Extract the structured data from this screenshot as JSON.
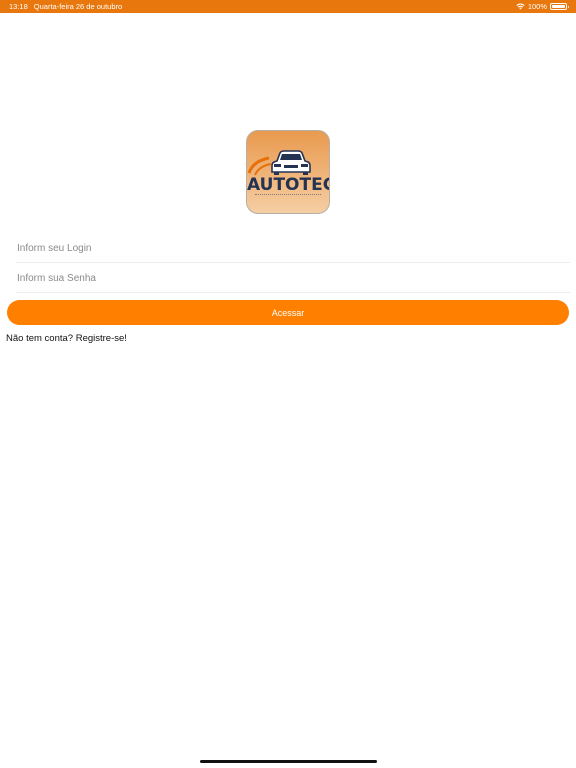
{
  "status_bar": {
    "time": "13:18",
    "date": "Quarta-feira 26 de outubro",
    "battery_text": "100%",
    "battery_level": 1.0,
    "icons": [
      "wifi-icon",
      "battery-icon"
    ]
  },
  "logo": {
    "text": "AUTOTEC",
    "icon": "car-icon"
  },
  "form": {
    "login_placeholder": "Inform seu Login",
    "senha_placeholder": "Inform sua Senha",
    "login_value": "",
    "senha_value": "",
    "submit_label": "Acessar",
    "register_text": "Não tem conta? Registre-se!"
  },
  "colors": {
    "accent": "#ff7f00",
    "status_bar": "#e8780e",
    "logo_text": "#243352"
  }
}
